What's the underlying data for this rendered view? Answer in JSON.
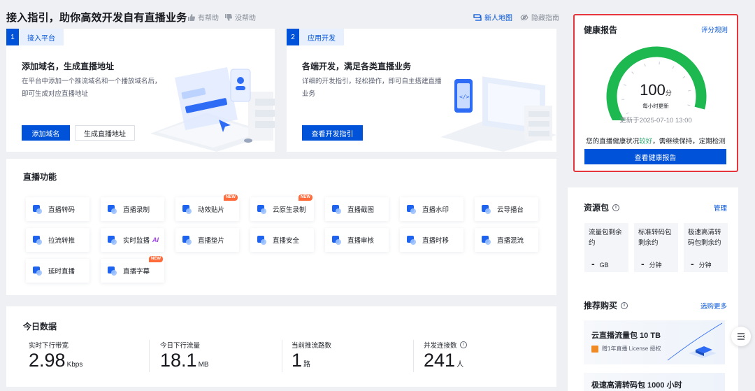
{
  "header": {
    "title": "接入指引，助你高效开发自有直播业务",
    "helpful": "有帮助",
    "not_helpful": "没帮助",
    "newbie_map": "新人地图",
    "hide_guide": "隐藏指南"
  },
  "steps": [
    {
      "num": "1",
      "tag": "接入平台",
      "title": "添加域名，生成直播地址",
      "desc": "在平台中添加一个推流域名和一个播放域名后，即可生成对应直播地址",
      "primary": "添加域名",
      "secondary": "生成直播地址"
    },
    {
      "num": "2",
      "tag": "应用开发",
      "title": "各端开发，满足各类直播业务",
      "desc": "详细的开发指引，轻松操作，即可自主搭建直播业务",
      "primary": "查看开发指引"
    }
  ],
  "features": {
    "title": "直播功能",
    "new_label": "NEW",
    "ai_label": "AI",
    "items": [
      {
        "label": "直播转码"
      },
      {
        "label": "直播录制"
      },
      {
        "label": "动效贴片"
      },
      {
        "label": "云原生录制"
      },
      {
        "label": "直播截图"
      },
      {
        "label": "直播水印"
      },
      {
        "label": "云导播台"
      },
      {
        "label": "拉流转推"
      },
      {
        "label": "实时监播"
      },
      {
        "label": "直播垫片"
      },
      {
        "label": "直播安全"
      },
      {
        "label": "直播审核"
      },
      {
        "label": "直播时移"
      },
      {
        "label": "直播混流"
      },
      {
        "label": "延时直播"
      },
      {
        "label": "直播字幕"
      }
    ]
  },
  "today": {
    "title": "今日数据",
    "metrics": [
      {
        "label": "实时下行带宽",
        "value": "2.98",
        "unit": "Kbps"
      },
      {
        "label": "今日下行流量",
        "value": "18.1",
        "unit": "MB"
      },
      {
        "label": "当前推流路数",
        "value": "1",
        "unit": "路"
      },
      {
        "label": "并发连接数",
        "value": "241",
        "unit": "人"
      }
    ]
  },
  "health": {
    "title": "健康报告",
    "rules_link": "评分规则",
    "score": "100",
    "score_unit": "分",
    "score_progress": 1.0,
    "refresh_note": "每小时更新",
    "updated": "更新于2025-07-10 13:00",
    "msg_before": "您的直播健康状况",
    "msg_status": "较好",
    "msg_after": "，需继续保持，定期检测",
    "button": "查看健康报告",
    "gauge_color": "#1db84f"
  },
  "resources": {
    "title": "资源包",
    "manage": "管理",
    "items": [
      {
        "label": "流量包剩余约",
        "value": "-",
        "unit": "GB"
      },
      {
        "label": "标准转码包剩余约",
        "value": "-",
        "unit": "分钟"
      },
      {
        "label": "极速高清转码包剩余约",
        "value": "-",
        "unit": "分钟"
      }
    ]
  },
  "recommend": {
    "title": "推荐购买",
    "more": "选购更多",
    "items": [
      {
        "title": "云直播流量包 10 TB",
        "sub": "赠1年直播 License 授权"
      },
      {
        "title": "极速高清转码包 1000 小时"
      }
    ]
  },
  "colors": {
    "brand": "#0052d9",
    "good": "#2ba471",
    "highlight_border": "#e5363d",
    "new_tag": "#ff6b3b"
  }
}
